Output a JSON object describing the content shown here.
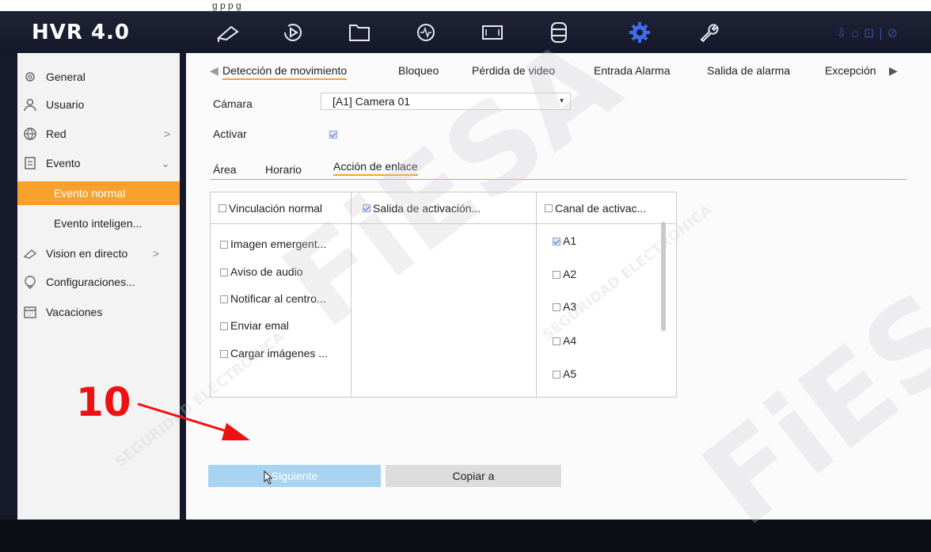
{
  "caption_fragment": "g    p  p    g",
  "app": {
    "title": "HVR 4.0"
  },
  "topbar": {
    "icons": [
      "live-view-icon",
      "playback-icon",
      "file-icon",
      "analytics-icon",
      "display-icon",
      "storage-icon",
      "settings-icon",
      "maintenance-icon"
    ],
    "active_icon": "settings-icon"
  },
  "sidebar": {
    "items": [
      {
        "label": "General",
        "icon": "gear-icon",
        "arrow": ""
      },
      {
        "label": "Usuario",
        "icon": "user-icon",
        "arrow": ""
      },
      {
        "label": "Red",
        "icon": "globe-icon",
        "arrow": ">"
      },
      {
        "label": "Evento",
        "icon": "event-icon",
        "arrow": "⌄"
      },
      {
        "label": "Vision en directo",
        "icon": "camera-icon",
        "arrow": ">"
      },
      {
        "label": "Configuraciones...",
        "icon": "chat-icon",
        "arrow": ""
      },
      {
        "label": "Vacaciones",
        "icon": "calendar-icon",
        "arrow": ""
      }
    ],
    "subitems": [
      {
        "label": "Evento normal",
        "active": true
      },
      {
        "label": "Evento inteligen...",
        "active": false
      }
    ]
  },
  "main": {
    "tabs": [
      {
        "label": "Detección de movimiento",
        "active": true
      },
      {
        "label": "Bloqueo",
        "active": false
      },
      {
        "label": "Pérdida de video",
        "active": false
      },
      {
        "label": "Entrada Alarma",
        "active": false
      },
      {
        "label": "Salida de alarma",
        "active": false
      },
      {
        "label": "Excepción",
        "active": false
      }
    ],
    "camera_label": "Cámara",
    "camera_value": "[A1] Camera 01",
    "enable_label": "Activar",
    "enable_checked": true,
    "subtabs": [
      {
        "label": "Área",
        "active": false
      },
      {
        "label": "Horario",
        "active": false
      },
      {
        "label": "Acción de enlace",
        "active": true
      }
    ],
    "table": {
      "headers": [
        "Vinculación normal",
        "Salida de activación...",
        "Canal de activac..."
      ],
      "header_checked": [
        false,
        true,
        false
      ],
      "normal_linkage": [
        "Imagen emergent...",
        "Aviso de audio",
        "Notificar al centro...",
        "Enviar emal",
        "Cargar imágenes ..."
      ],
      "channels": [
        {
          "label": "A1",
          "checked": true
        },
        {
          "label": "A2",
          "checked": false
        },
        {
          "label": "A3",
          "checked": false
        },
        {
          "label": "A4",
          "checked": false
        },
        {
          "label": "A5",
          "checked": false
        }
      ]
    },
    "buttons": {
      "next": "Siguiente",
      "copy": "Copiar a"
    }
  },
  "annotation": {
    "step": "10"
  },
  "watermark": {
    "text": "FiESA",
    "subtext": "SEGURIDAD ELECTRONICA"
  },
  "colors": {
    "accent": "#f8a12f",
    "annotation": "#ee1111",
    "next_button": "#a8d4f2"
  }
}
